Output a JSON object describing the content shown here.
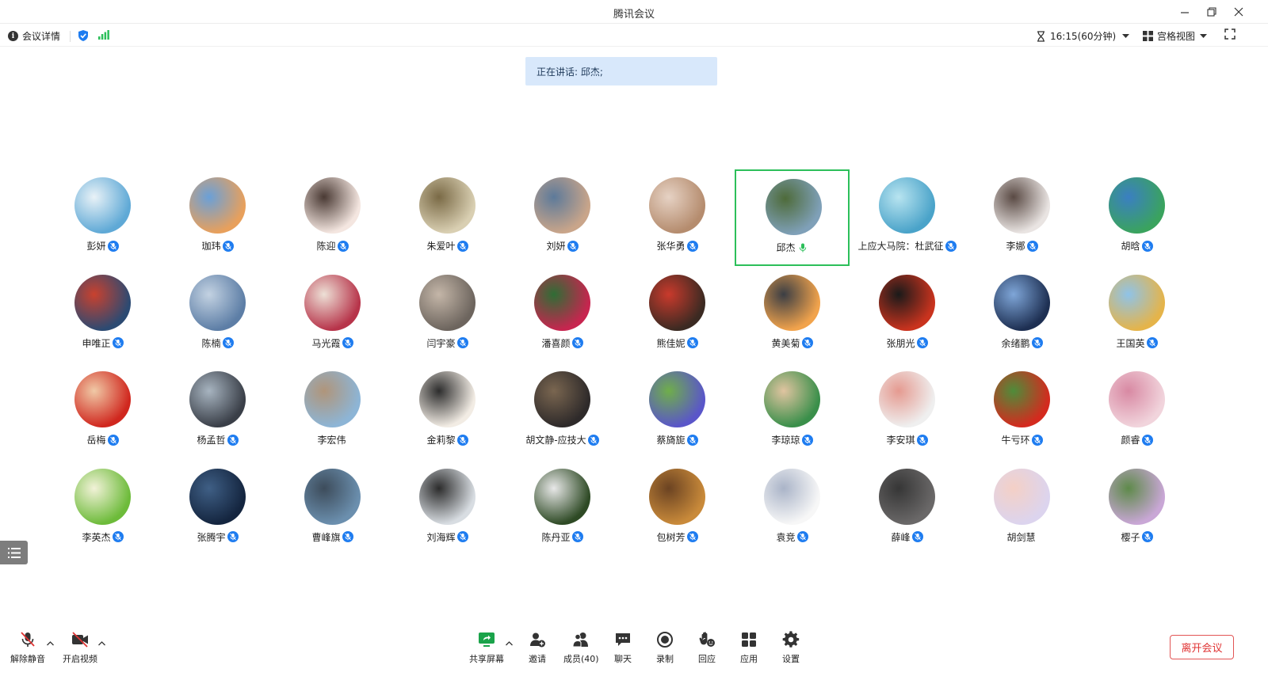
{
  "window": {
    "title": "腾讯会议"
  },
  "infobar": {
    "meeting_details": "会议详情",
    "timer": "16:15(60分钟)",
    "view_mode": "宫格视图"
  },
  "speaking": {
    "text": "正在讲话: 邱杰;"
  },
  "colors": {
    "accent_blue": "#1e7cf0",
    "active_green": "#2cbf5a",
    "leave_red": "#e03333",
    "banner_bg": "#d8e8fb"
  },
  "participants": [
    {
      "name": "彭妍",
      "mic": "blue"
    },
    {
      "name": "珈玮",
      "mic": "blue"
    },
    {
      "name": "陈迎",
      "mic": "blue"
    },
    {
      "name": "朱爱叶",
      "mic": "blue"
    },
    {
      "name": "刘妍",
      "mic": "blue"
    },
    {
      "name": "张华勇",
      "mic": "blue"
    },
    {
      "name": "邱杰",
      "mic": "green",
      "active": true
    },
    {
      "name": "上应大马院：杜武征",
      "mic": "blue"
    },
    {
      "name": "李娜",
      "mic": "blue"
    },
    {
      "name": "胡晗",
      "mic": "blue"
    },
    {
      "name": "申唯正",
      "mic": "blue"
    },
    {
      "name": "陈楠",
      "mic": "blue"
    },
    {
      "name": "马光霞",
      "mic": "blue"
    },
    {
      "name": "闫宇豪",
      "mic": "blue"
    },
    {
      "name": "潘喜颜",
      "mic": "blue"
    },
    {
      "name": "熊佳妮",
      "mic": "blue"
    },
    {
      "name": "黄美菊",
      "mic": "blue"
    },
    {
      "name": "张朋光",
      "mic": "blue"
    },
    {
      "name": "余绪鹏",
      "mic": "blue"
    },
    {
      "name": "王国英",
      "mic": "blue"
    },
    {
      "name": "岳梅",
      "mic": "blue"
    },
    {
      "name": "杨孟哲",
      "mic": "blue"
    },
    {
      "name": "李宏伟",
      "mic": "none"
    },
    {
      "name": "金莉黎",
      "mic": "blue"
    },
    {
      "name": "胡文静-应技大",
      "mic": "blue"
    },
    {
      "name": "蔡旖旎",
      "mic": "blue"
    },
    {
      "name": "李琼琼",
      "mic": "blue"
    },
    {
      "name": "李安琪",
      "mic": "blue"
    },
    {
      "name": "牛亏环",
      "mic": "blue"
    },
    {
      "name": "颜睿",
      "mic": "blue"
    },
    {
      "name": "李英杰",
      "mic": "blue"
    },
    {
      "name": "张腾宇",
      "mic": "blue"
    },
    {
      "name": "曹峰旗",
      "mic": "blue"
    },
    {
      "name": "刘海辉",
      "mic": "blue"
    },
    {
      "name": "陈丹亚",
      "mic": "blue"
    },
    {
      "name": "包树芳",
      "mic": "blue"
    },
    {
      "name": "袁竞",
      "mic": "blue"
    },
    {
      "name": "薛峰",
      "mic": "blue"
    },
    {
      "name": "胡剑慧",
      "mic": "none"
    },
    {
      "name": "樱子",
      "mic": "blue"
    }
  ],
  "toolbar": {
    "unmute": "解除静音",
    "start_video": "开启视频",
    "share_screen": "共享屏幕",
    "invite": "邀请",
    "members": "成员(40)",
    "chat": "聊天",
    "record": "录制",
    "reactions": "回应",
    "apps": "应用",
    "settings": "设置",
    "leave": "离开会议"
  }
}
